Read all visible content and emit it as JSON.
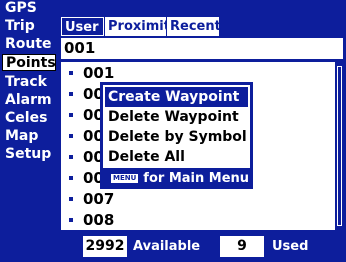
{
  "sidebar": {
    "items": [
      {
        "label": "GPS"
      },
      {
        "label": "Trip"
      },
      {
        "label": "Route"
      },
      {
        "label": "Points"
      },
      {
        "label": "Track"
      },
      {
        "label": "Alarm"
      },
      {
        "label": "Celes"
      },
      {
        "label": "Map"
      },
      {
        "label": "Setup"
      }
    ],
    "active": "Points"
  },
  "tabs": [
    {
      "label": "User"
    },
    {
      "label": "Proximity"
    },
    {
      "label": "Recent"
    }
  ],
  "active_tab": "User",
  "search": {
    "value": "001"
  },
  "list": {
    "items": [
      {
        "label": "001"
      },
      {
        "label": "00"
      },
      {
        "label": "00"
      },
      {
        "label": "00"
      },
      {
        "label": "00"
      },
      {
        "label": "00"
      },
      {
        "label": "007"
      },
      {
        "label": "008"
      }
    ]
  },
  "menu": {
    "items": [
      {
        "label": "Create Waypoint"
      },
      {
        "label": "Delete Waypoint"
      },
      {
        "label": "Delete by Symbol"
      },
      {
        "label": "Delete All"
      }
    ],
    "selected": "Create Waypoint",
    "footer_key": "MENU",
    "footer_text": "for Main Menu"
  },
  "footer": {
    "available_count": "2992",
    "available_label": "Available",
    "used_count": "9",
    "used_label": "Used"
  },
  "colors": {
    "background": "#0d1e9c",
    "panel": "#ffffff",
    "highlight": "#0d1e9c"
  }
}
